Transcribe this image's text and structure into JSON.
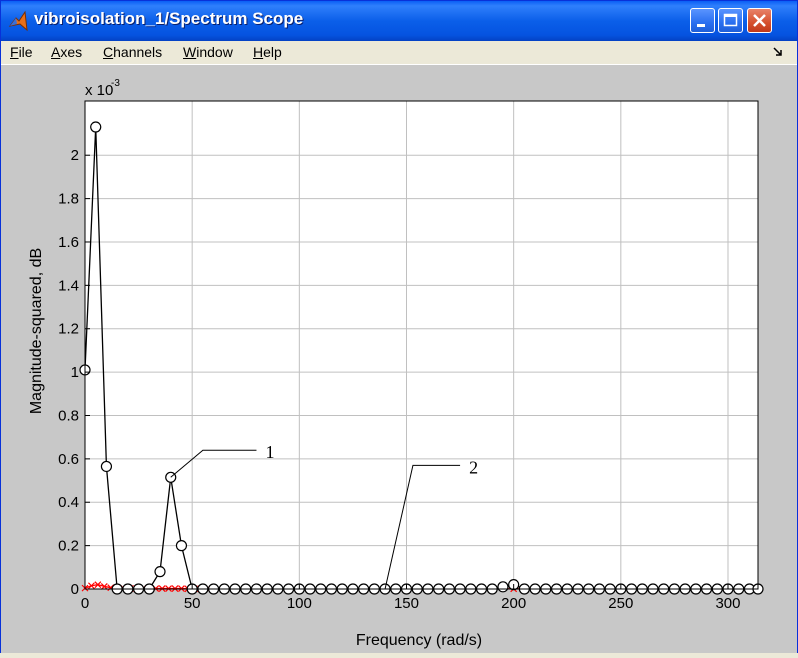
{
  "window": {
    "title": "vibroisolation_1/Spectrum Scope",
    "icon": "matlab-logo-icon"
  },
  "menu": [
    {
      "label": "File",
      "hotkey": "F",
      "rest": "ile"
    },
    {
      "label": "Axes",
      "hotkey": "A",
      "rest": "xes"
    },
    {
      "label": "Channels",
      "hotkey": "C",
      "rest": "hannels"
    },
    {
      "label": "Window",
      "hotkey": "W",
      "rest": "indow"
    },
    {
      "label": "Help",
      "hotkey": "H",
      "rest": "elp"
    }
  ],
  "colors": {
    "series1": "#000000",
    "series2": "#ff0000",
    "plot_bg": "#ffffff",
    "figure_bg": "#c8c8c8",
    "grid": "#c0c0c0"
  },
  "chart_data": {
    "type": "line",
    "xlabel": "Frequency (rad/s)",
    "ylabel": "Magnitude-squared, dB",
    "y_exponent_label": "x 10",
    "y_exponent": "-3",
    "xlim": [
      0,
      314
    ],
    "ylim": [
      0,
      2.25
    ],
    "xticks": [
      0,
      50,
      100,
      150,
      200,
      250,
      300
    ],
    "yticks": [
      0,
      0.2,
      0.4,
      0.6,
      0.8,
      1,
      1.2,
      1.4,
      1.6,
      1.8,
      2
    ],
    "ytick_labels": [
      "0",
      "0.2",
      "0.4",
      "0.6",
      "0.8",
      "1",
      "1.2",
      "1.4",
      "1.6",
      "1.8",
      "2"
    ],
    "grid": true,
    "series": [
      {
        "marker": "circle",
        "x": [
          0,
          5,
          10,
          15,
          20,
          25,
          30,
          35,
          40,
          45,
          50,
          55,
          60,
          65,
          70,
          75,
          80,
          85,
          90,
          95,
          100,
          105,
          110,
          115,
          120,
          125,
          130,
          135,
          140,
          145,
          150,
          155,
          160,
          165,
          170,
          175,
          180,
          185,
          190,
          195,
          200,
          205,
          210,
          215,
          220,
          225,
          230,
          235,
          240,
          245,
          250,
          255,
          260,
          265,
          270,
          275,
          280,
          285,
          290,
          295,
          300,
          305,
          310,
          314
        ],
        "y": [
          1.01,
          2.13,
          0.565,
          0,
          0,
          0,
          0,
          0.08,
          0.515,
          0.2,
          0,
          0,
          0,
          0,
          0,
          0,
          0,
          0,
          0,
          0,
          0,
          0,
          0,
          0,
          0,
          0,
          0,
          0,
          0,
          0,
          0,
          0,
          0,
          0,
          0,
          0,
          0,
          0,
          0,
          0.01,
          0.02,
          0,
          0,
          0,
          0,
          0,
          0,
          0,
          0,
          0,
          0,
          0,
          0,
          0,
          0,
          0,
          0,
          0,
          0,
          0,
          0,
          0,
          0,
          0
        ]
      },
      {
        "marker": "x",
        "x": [
          0,
          3,
          6,
          9,
          12,
          15,
          18,
          21,
          24,
          27,
          30,
          33,
          36,
          39,
          42,
          45,
          48,
          51,
          54,
          57,
          60,
          70,
          80,
          90,
          100,
          110,
          120,
          130,
          140,
          150,
          160,
          170,
          180,
          190,
          200,
          210,
          220,
          230,
          240,
          250,
          260,
          270,
          280,
          290,
          300,
          310,
          314
        ],
        "y": [
          0.004,
          0.015,
          0.02,
          0.012,
          0.006,
          0.004,
          0.003,
          0.002,
          0.002,
          0.002,
          0.002,
          0.002,
          0.002,
          0.002,
          0.002,
          0.002,
          0.001,
          0.001,
          0.001,
          0.001,
          0.001,
          0.001,
          0.001,
          0.001,
          0.001,
          0.001,
          0.001,
          0.001,
          0.001,
          0.001,
          0.001,
          0.001,
          0.001,
          0.001,
          0.001,
          0.001,
          0.001,
          0.001,
          0.001,
          0.001,
          0.001,
          0.001,
          0.001,
          0.001,
          0.001,
          0.001,
          0.001
        ]
      }
    ],
    "annotations": [
      {
        "text": "1",
        "point_x": 40,
        "point_y": 0.515,
        "elbow_x": 55,
        "elbow_y": 0.64,
        "label_x": 80,
        "label_y": 0.64
      },
      {
        "text": "2",
        "point_x": 140,
        "point_y": 0,
        "elbow_x": 153,
        "elbow_y": 0.57,
        "label_x": 175,
        "label_y": 0.57
      }
    ]
  }
}
